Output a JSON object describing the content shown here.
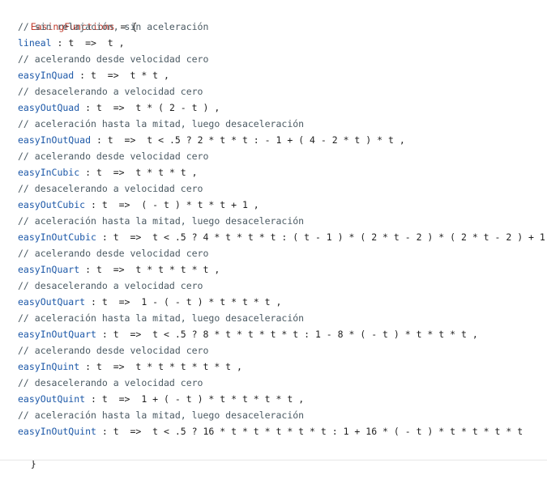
{
  "code": {
    "object_name": "EasingFunctions",
    "open": " = {",
    "close": "}",
    "lines": [
      {
        "type": "comment",
        "text": "// sin relajación, sin aceleración"
      },
      {
        "type": "prop",
        "name": "lineal",
        "expr": " : t  =>  t ,"
      },
      {
        "type": "comment",
        "text": "// acelerando desde velocidad cero"
      },
      {
        "type": "prop",
        "name": "easyInQuad",
        "expr": " : t  =>  t * t ,"
      },
      {
        "type": "comment",
        "text": "// desacelerando a velocidad cero"
      },
      {
        "type": "prop",
        "name": "easyOutQuad",
        "expr": " : t  =>  t * ( 2 - t ) ,"
      },
      {
        "type": "comment",
        "text": "// aceleración hasta la mitad, luego desaceleración"
      },
      {
        "type": "prop",
        "name": "easyInOutQuad",
        "expr": " : t  =>  t < .5 ? 2 * t * t : - 1 + ( 4 - 2 * t ) * t ,"
      },
      {
        "type": "comment",
        "text": "// acelerando desde velocidad cero"
      },
      {
        "type": "prop",
        "name": "easyInCubic",
        "expr": " : t  =>  t * t * t ,"
      },
      {
        "type": "comment",
        "text": "// desacelerando a velocidad cero"
      },
      {
        "type": "prop",
        "name": "easyOutCubic",
        "expr": " : t  =>  ( - t ) * t * t + 1 ,"
      },
      {
        "type": "comment",
        "text": "// aceleración hasta la mitad, luego desaceleración"
      },
      {
        "type": "prop",
        "name": "easyInOutCubic",
        "expr": " : t  =>  t < .5 ? 4 * t * t * t : ( t - 1 ) * ( 2 * t - 2 ) * ( 2 * t - 2 ) + 1 ,"
      },
      {
        "type": "comment",
        "text": "// acelerando desde velocidad cero"
      },
      {
        "type": "prop",
        "name": "easyInQuart",
        "expr": " : t  =>  t * t * t * t ,"
      },
      {
        "type": "comment",
        "text": "// desacelerando a velocidad cero"
      },
      {
        "type": "prop",
        "name": "easyOutQuart",
        "expr": " : t  =>  1 - ( - t ) * t * t * t ,"
      },
      {
        "type": "comment",
        "text": "// aceleración hasta la mitad, luego desaceleración"
      },
      {
        "type": "prop",
        "name": "easyInOutQuart",
        "expr": " : t  =>  t < .5 ? 8 * t * t * t * t : 1 - 8 * ( - t ) * t * t * t ,"
      },
      {
        "type": "comment",
        "text": "// acelerando desde velocidad cero"
      },
      {
        "type": "prop",
        "name": "easyInQuint",
        "expr": " : t  =>  t * t * t * t * t ,"
      },
      {
        "type": "comment",
        "text": "// desacelerando a velocidad cero"
      },
      {
        "type": "prop",
        "name": "easyOutQuint",
        "expr": " : t  =>  1 + ( - t ) * t * t * t * t ,"
      },
      {
        "type": "comment",
        "text": "// aceleración hasta la mitad, luego desaceleración"
      },
      {
        "type": "prop",
        "name": "easyInOutQuint",
        "expr": " : t  =>  t < .5 ? 16 * t * t * t * t * t : 1 + 16 * ( - t ) * t * t * t * t"
      }
    ]
  },
  "colors": {
    "key": "#c0392b",
    "property": "#1c58a8",
    "comment": "#4b5a63",
    "text": "#1f1f1f",
    "background": "#ffffff"
  }
}
